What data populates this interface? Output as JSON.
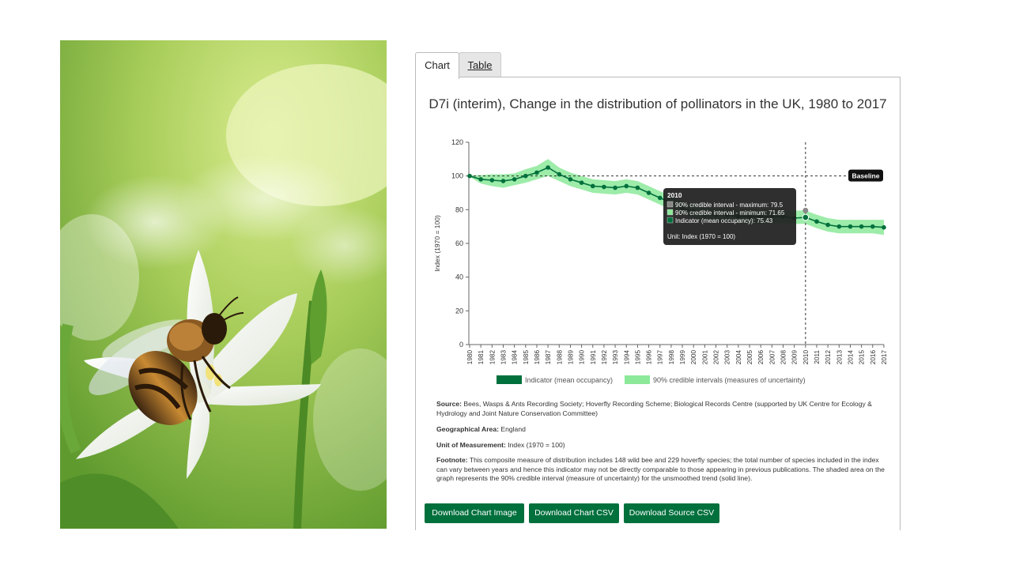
{
  "tabs": {
    "chart": "Chart",
    "table": "Table"
  },
  "chart_data": {
    "type": "line",
    "title": "D7i (interim), Change in the distribution of pollinators in the UK, 1980 to 2017",
    "ylabel": "Index (1970 = 100)",
    "xlabel": "",
    "ylim": [
      0,
      120
    ],
    "yticks": [
      0,
      20,
      40,
      60,
      80,
      100,
      120
    ],
    "grid": false,
    "legend_position": "bottom",
    "categories": [
      "1980",
      "1981",
      "1982",
      "1983",
      "1984",
      "1985",
      "1986",
      "1987",
      "1988",
      "1989",
      "1990",
      "1991",
      "1992",
      "1993",
      "1994",
      "1995",
      "1996",
      "1997",
      "1998",
      "1999",
      "2000",
      "2001",
      "2002",
      "2003",
      "2004",
      "2005",
      "2006",
      "2007",
      "2008",
      "2009",
      "2010",
      "2011",
      "2012",
      "2013",
      "2014",
      "2015",
      "2016",
      "2017"
    ],
    "series": [
      {
        "name": "Indicator (mean occupancy)",
        "color": "#00703c",
        "values": [
          100,
          98,
          97.5,
          97,
          98,
          100,
          102,
          105,
          101,
          98,
          96,
          94,
          93.5,
          93,
          94,
          93,
          90,
          87,
          84,
          81,
          79,
          77,
          77,
          77,
          76,
          76,
          76,
          76,
          76,
          75,
          75.43,
          73,
          71,
          70,
          70,
          70,
          70,
          69.5
        ]
      },
      {
        "name": "90% credible intervals (measures of uncertainty)",
        "color": "#8ce99a",
        "upper": [
          100.5,
          100.5,
          101,
          101,
          101.5,
          104,
          106,
          110,
          105,
          102,
          100,
          98,
          97.5,
          97,
          98,
          97,
          94,
          91,
          88,
          85,
          83,
          81,
          81,
          81,
          80,
          80,
          80,
          80,
          80,
          79.5,
          79.5,
          77,
          75,
          74,
          74,
          74,
          74,
          74
        ],
        "lower": [
          99.5,
          95.5,
          94,
          93,
          94.5,
          96,
          98,
          100,
          97,
          94,
          92,
          90,
          89.5,
          89,
          90,
          89,
          86,
          83,
          80,
          77,
          75,
          73,
          73,
          73,
          72,
          72,
          72,
          72,
          72,
          71.5,
          71.65,
          69,
          67,
          66,
          66,
          66,
          66,
          65
        ]
      }
    ],
    "baseline": {
      "value": 100,
      "label": "Baseline"
    },
    "highlight_year": "2010",
    "tooltip": {
      "title": "2010",
      "rows": [
        {
          "label": "90% credible interval - maximum: 79.5",
          "color": "#888888"
        },
        {
          "label": "90% credible interval - minimum: 71.65",
          "color": "#8ce99a"
        },
        {
          "label": "Indicator (mean occupancy): 75.43",
          "color": "#00703c"
        }
      ],
      "unit": "Unit: Index (1970 = 100)"
    }
  },
  "meta": {
    "source_label": "Source:",
    "source": "Bees, Wasps & Ants Recording Society; Hoverfly Recording Scheme; Biological Records Centre (supported by UK Centre for Ecology & Hydrology and Joint Nature Conservation Committee)",
    "area_label": "Geographical Area:",
    "area": "England",
    "unit_label": "Unit of Measurement:",
    "unit": "Index (1970 = 100)",
    "footnote_label": "Footnote:",
    "footnote": "This composite measure of distribution includes 148 wild bee and 229 hoverfly species; the total number of species included in the index can vary between years and hence this indicator may not be directly comparable to those appearing in previous publications. The shaded area on the graph represents the 90% credible interval (measure of uncertainty) for the unsmoothed trend (solid line)."
  },
  "buttons": {
    "image": "Download Chart Image",
    "csv": "Download Chart CSV",
    "source": "Download Source CSV"
  },
  "photo": {
    "subject": "bee-on-white-flower"
  }
}
